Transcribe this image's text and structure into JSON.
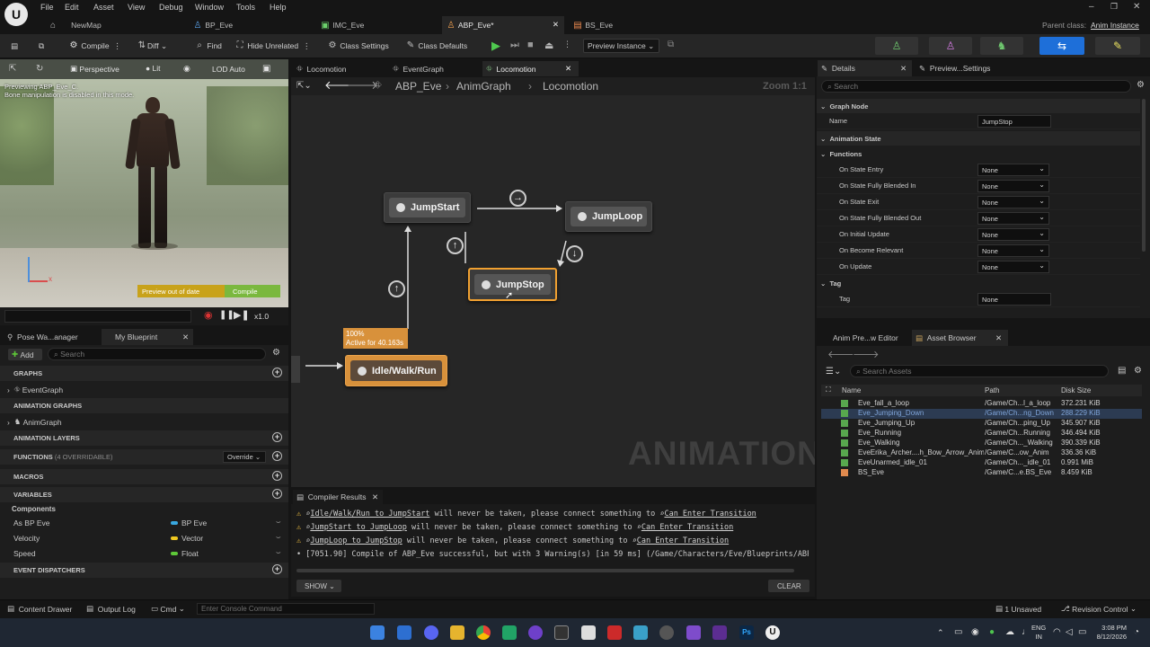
{
  "menu": {
    "items": [
      "File",
      "Edit",
      "Asset",
      "View",
      "Debug",
      "Window",
      "Tools",
      "Help"
    ]
  },
  "tabs": [
    {
      "label": "NewMap"
    },
    {
      "label": "BP_Eve"
    },
    {
      "label": "IMC_Eve"
    },
    {
      "label": "ABP_Eve*"
    },
    {
      "label": "BS_Eve"
    }
  ],
  "parent_class": {
    "label": "Parent class:",
    "value": "Anim Instance"
  },
  "toolbar": {
    "compile": "Compile",
    "diff": "Diff",
    "find": "Find",
    "hide_unrelated": "Hide Unrelated",
    "class_settings": "Class Settings",
    "class_defaults": "Class Defaults",
    "preview_instance": "Preview Instance"
  },
  "viewport": {
    "perspective": "Perspective",
    "lit": "Lit",
    "lod": "LOD Auto",
    "preview_line1": "Previewing ABP_Eve_C.",
    "preview_line2": "Bone manipulation is disabled in this mode.",
    "out_of_date": "Preview out of date",
    "compile": "Compile",
    "speed": "x1.0"
  },
  "graph_tabs": {
    "t1": "Locomotion",
    "t2": "EventGraph",
    "t3": "Locomotion"
  },
  "breadcrumb": {
    "b1": "ABP_Eve",
    "b2": "AnimGraph",
    "b3": "Locomotion",
    "zoom": "Zoom 1:1"
  },
  "nodes": {
    "jumpstart": "JumpStart",
    "jumploop": "JumpLoop",
    "jumpstop": "JumpStop",
    "idle": "Idle/Walk/Run",
    "idle_pct": "100%",
    "idle_active": "Active for 40.163s"
  },
  "watermark": "ANIMATION",
  "left": {
    "tab1": "Pose Wa...anager",
    "tab2": "My Blueprint",
    "add": "Add",
    "search": "Search",
    "graphs": "GRAPHS",
    "eventgraph": "EventGraph",
    "anim_graphs": "ANIMATION GRAPHS",
    "animgraph": "AnimGraph",
    "anim_layers": "ANIMATION LAYERS",
    "functions": "FUNCTIONS",
    "overridable": "(4 OVERRIDABLE)",
    "override": "Override",
    "macros": "MACROS",
    "variables": "VARIABLES",
    "components": "Components",
    "vars": [
      {
        "name": "As BP Eve",
        "type": "BP Eve",
        "color": "#39a8e0"
      },
      {
        "name": "Velocity",
        "type": "Vector",
        "color": "#f0c820"
      },
      {
        "name": "Speed",
        "type": "Float",
        "color": "#5ec838"
      }
    ],
    "dispatchers": "EVENT DISPATCHERS"
  },
  "compiler": {
    "title": "Compiler Results",
    "w1a": "Idle/Walk/Run to JumpStart",
    "w1b": "will never be taken, please connect something to",
    "w1c": "Can Enter Transition",
    "w2a": "JumpStart to JumpLoop",
    "w2b": "will never be taken, please connect something to",
    "w2c": "Can Enter Transition",
    "w3a": "JumpLoop to JumpStop",
    "w3b": "will never be taken, please connect something to",
    "w3c": "Can Enter Transition",
    "info": "[7051.90] Compile of ABP_Eve successful, but with 3 Warning(s) [in 59 ms] (/Game/Characters/Eve/Blueprints/ABP_Eve.ABP_E",
    "show": "SHOW",
    "clear": "CLEAR"
  },
  "details": {
    "tab1": "Details",
    "tab2": "Preview...Settings",
    "search": "Search",
    "graph_node": "Graph Node",
    "name_label": "Name",
    "name_value": "JumpStop",
    "anim_state": "Animation State",
    "functions": "Functions",
    "rows": [
      {
        "label": "On State Entry",
        "value": "None"
      },
      {
        "label": "On State Fully Blended In",
        "value": "None"
      },
      {
        "label": "On State Exit",
        "value": "None"
      },
      {
        "label": "On State Fully Blended Out",
        "value": "None"
      },
      {
        "label": "On Initial Update",
        "value": "None"
      },
      {
        "label": "On Become Relevant",
        "value": "None"
      },
      {
        "label": "On Update",
        "value": "None"
      }
    ],
    "tag_section": "Tag",
    "tag_label": "Tag",
    "tag_value": "None"
  },
  "assets": {
    "tab1": "Anim Pre...w Editor",
    "tab2": "Asset Browser",
    "search": "Search Assets",
    "col_name": "Name",
    "col_path": "Path",
    "col_size": "Disk Size",
    "rows": [
      {
        "name": "Eve_fall_a_loop",
        "path": "/Game/Ch...l_a_loop",
        "size": "372.231 KiB"
      },
      {
        "name": "Eve_Jumping_Down",
        "path": "/Game/Ch...ng_Down",
        "size": "288.229 KiB"
      },
      {
        "name": "Eve_Jumping_Up",
        "path": "/Game/Ch...ping_Up",
        "size": "345.907 KiB"
      },
      {
        "name": "Eve_Running",
        "path": "/Game/Ch...Running",
        "size": "346.494 KiB"
      },
      {
        "name": "Eve_Walking",
        "path": "/Game/Ch..._Walking",
        "size": "390.339 KiB"
      },
      {
        "name": "EveErika_Archer....h_Bow_Arrow_Anim",
        "path": "/Game/C...ow_Anim",
        "size": "336.36 KiB"
      },
      {
        "name": "EveUnarmed_idle_01",
        "path": "/Game/Ch..._idle_01",
        "size": "0.991 MiB"
      },
      {
        "name": "BS_Eve",
        "path": "/Game/C...e.BS_Eve",
        "size": "8.459 KiB"
      }
    ]
  },
  "statusbar": {
    "content_drawer": "Content Drawer",
    "output_log": "Output Log",
    "cmd": "Cmd",
    "console": "Enter Console Command",
    "unsaved": "1 Unsaved",
    "revision": "Revision Control"
  },
  "taskbar": {
    "lang1": "ENG",
    "lang2": "IN",
    "time": "3:08 PM",
    "date": "8/12/2026"
  }
}
